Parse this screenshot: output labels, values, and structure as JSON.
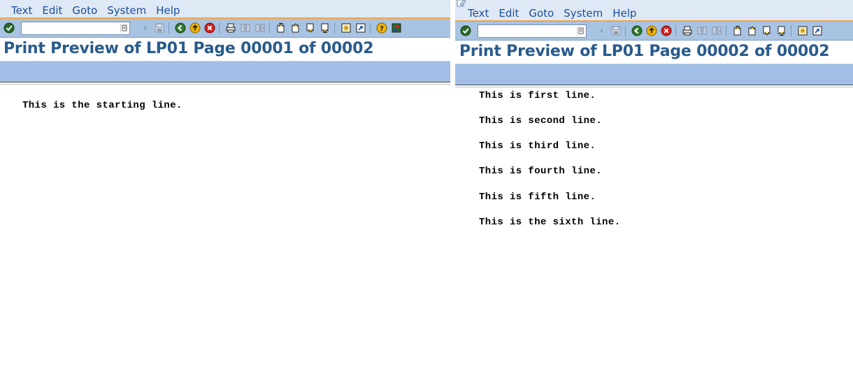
{
  "left": {
    "menu": [
      "Text",
      "Edit",
      "Goto",
      "System",
      "Help"
    ],
    "title": "Print Preview of LP01 Page 00001 of 00002",
    "lines": [
      "This is the starting line."
    ]
  },
  "right": {
    "menu": [
      "Text",
      "Edit",
      "Goto",
      "System",
      "Help"
    ],
    "title": "Print Preview of LP01 Page 00002 of 00002",
    "lines": [
      "This is first line.",
      "This is second line.",
      "This is third line.",
      "This is fourth line.",
      "This is fifth line.",
      "This is the sixth line."
    ]
  },
  "icons": {
    "enter": "checkmark-icon",
    "back": "back-icon",
    "exit": "exit-icon",
    "cancel": "cancel-icon",
    "print": "print-icon",
    "find": "find-icon",
    "find_next": "find-next-icon",
    "first_page": "first-page-icon",
    "previous_page": "previous-page-icon",
    "next_page": "next-page-icon",
    "last_page": "last-page-icon",
    "new_session": "new-session-icon",
    "shortcut": "shortcut-icon",
    "help": "help-icon",
    "layout": "layout-menu-icon"
  },
  "colors": {
    "menubar_bg": "#dfe9f5",
    "toolbar_bg": "#a9c3e2",
    "appbar_bg": "#a2bee6",
    "title_color": "#295b8c",
    "accent_orange": "#f0a448"
  }
}
